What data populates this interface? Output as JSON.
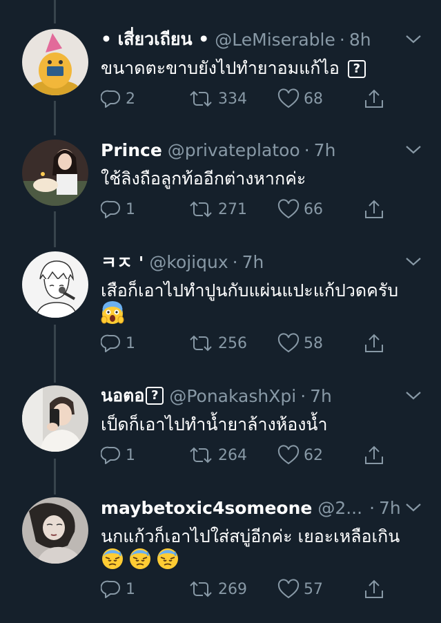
{
  "colors": {
    "background": "#15202b",
    "muted": "#8899a6",
    "thread_line": "#38444d",
    "text": "#ffffff"
  },
  "tweets": [
    {
      "name": "• เสี่ยวเถียน •",
      "handle": "@LeMiserable",
      "sep": "·",
      "time": "8h",
      "text": "ขนาดตะขาบยังไปทำยาอมแก้ไอ",
      "text_suffix": "?",
      "replies": "2",
      "retweets": "334",
      "likes": "68"
    },
    {
      "name": "Prince",
      "handle": "@privateplatoo",
      "sep": "·",
      "time": "7h",
      "text": "ใช้ลิงถือลูกท้ออีกต่างหากค่ะ",
      "replies": "1",
      "retweets": "271",
      "likes": "66"
    },
    {
      "name": "ㅋㅈ '",
      "handle": "@kojiqux",
      "sep": "·",
      "time": "7h",
      "text": "เสือก็เอาไปทำปูนกับแผ่นแปะแก้ปวดครับ",
      "emojis": [
        "screaming-face"
      ],
      "replies": "1",
      "retweets": "256",
      "likes": "58"
    },
    {
      "name": "นอตอ",
      "name_suffix": "?",
      "handle": "@PonakashXpi",
      "sep": "·",
      "time": "7h",
      "text": "เป็ดก็เอาไปทำน้ำยาล้างห้องน้ำ",
      "replies": "1",
      "retweets": "264",
      "likes": "62"
    },
    {
      "name": "maybetoxic4someone",
      "handle": "@2...",
      "sep": "·",
      "time": "7h",
      "text": "นกแก้วก็เอาไปใส่สบู่อีกค่ะ เยอะเหลือเกิน",
      "emojis": [
        "downcast-sweat-face",
        "downcast-sweat-face",
        "downcast-sweat-face"
      ],
      "replies": "1",
      "retweets": "269",
      "likes": "57"
    }
  ]
}
